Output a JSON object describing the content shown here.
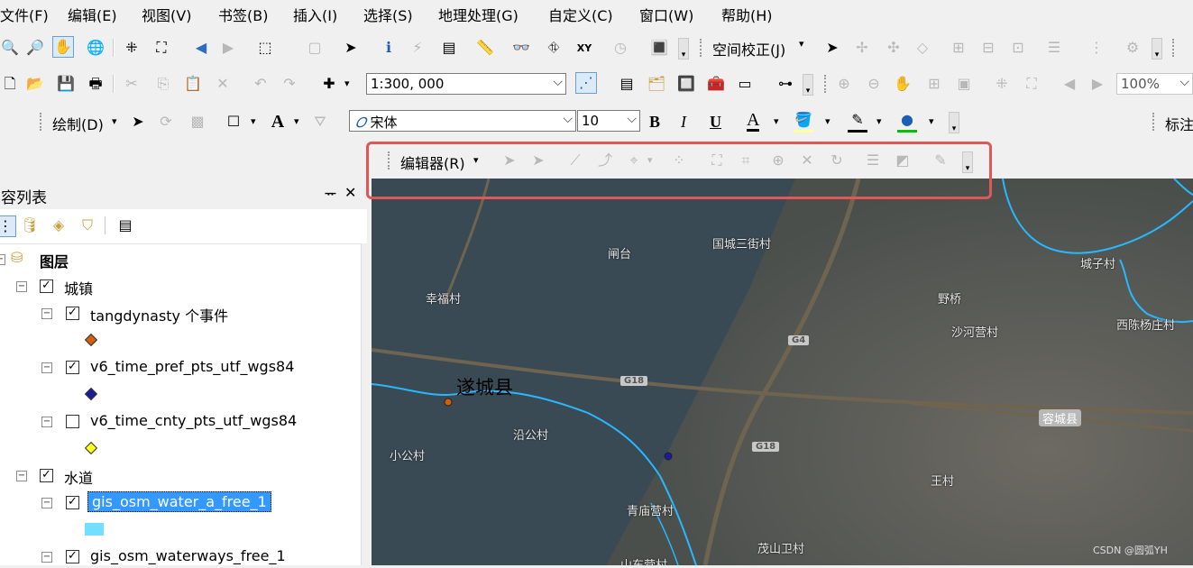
{
  "menu": [
    "文件(F)",
    "编辑(E)",
    "视图(V)",
    "书签(B)",
    "插入(I)",
    "选择(S)",
    "地理处理(G)",
    "自定义(C)",
    "窗口(W)",
    "帮助(H)"
  ],
  "toolbar1": {
    "georef_label": "空间校正(J)"
  },
  "toolbar2": {
    "scale": "1:300, 000",
    "zoom": "100%"
  },
  "toolbar3": {
    "draw_label": "绘制(D)",
    "font": "宋体",
    "size": "10",
    "bold": "B",
    "italic": "I",
    "underline": "U",
    "text_a": "A",
    "annotation_label": "标注"
  },
  "editor": {
    "label": "编辑器(R)"
  },
  "toc": {
    "title": "内容列表",
    "pin": "ᅲ",
    "close": "✕",
    "root": "图层",
    "items": [
      {
        "name": "城镇",
        "checked": true,
        "level": 1
      },
      {
        "name": "tangdynasty 个事件",
        "checked": true,
        "level": 2
      },
      {
        "name": "v6_time_pref_pts_utf_wgs84",
        "checked": true,
        "level": 2
      },
      {
        "name": "v6_time_cnty_pts_utf_wgs84",
        "checked": false,
        "level": 2
      },
      {
        "name": "水道",
        "checked": true,
        "level": 1
      },
      {
        "name": "gis_osm_water_a_free_1",
        "checked": true,
        "level": 2
      },
      {
        "name": "gis_osm_waterways_free_1",
        "checked": true,
        "level": 2
      }
    ]
  },
  "map": {
    "places": [
      "闸台",
      "国城三街村",
      "城子村",
      "幸福村",
      "野桥",
      "沙河营村",
      "西陈杨庄村",
      "遂城县",
      "沿公村",
      "小公村",
      "容城县",
      "王村",
      "青庙营村",
      "茂山卫村",
      "山东营村"
    ],
    "roads": [
      "G4",
      "G18",
      "G18"
    ],
    "watermark": "CSDN @圆弧YH"
  },
  "colors": {
    "highlight": "#e05757",
    "selection": "#3399ff",
    "water_legend": "#73dfff"
  }
}
